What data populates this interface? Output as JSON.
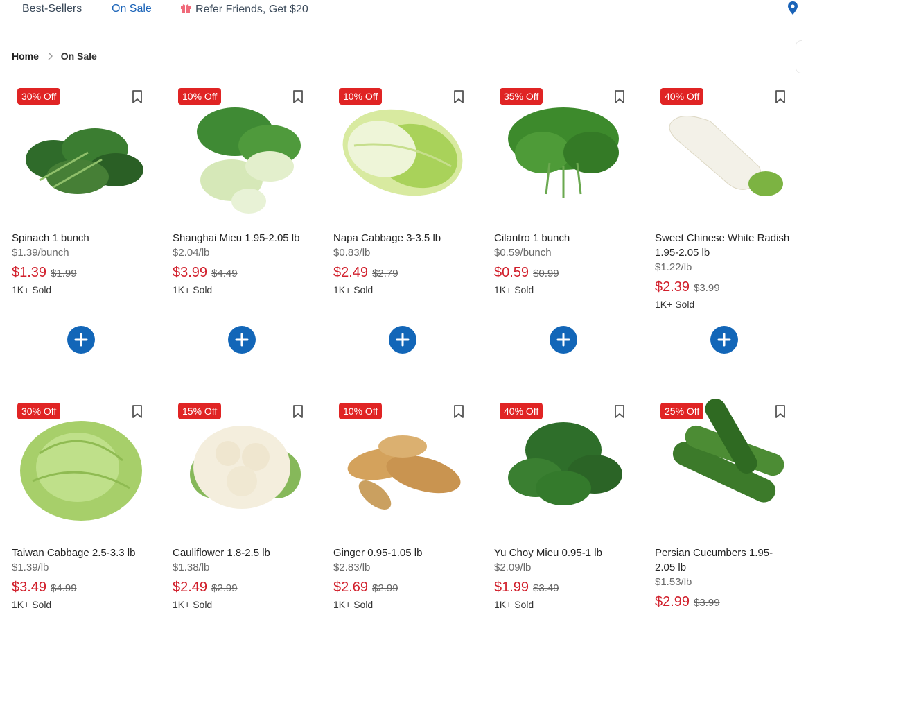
{
  "nav": {
    "best_sellers": "Best-Sellers",
    "on_sale": "On Sale",
    "refer": "Refer Friends, Get $20"
  },
  "breadcrumb": {
    "home": "Home",
    "current": "On Sale"
  },
  "colors": {
    "accent": "#1266b8",
    "badge": "#e02424",
    "price": "#d11f2b"
  },
  "products": [
    {
      "discount": "30% Off",
      "name": "Spinach 1 bunch",
      "unit_price": "$1.39/bunch",
      "price": "$1.39",
      "original_price": "$1.99",
      "sold": "1K+ Sold",
      "image": "spinach"
    },
    {
      "discount": "10% Off",
      "name": "Shanghai Mieu 1.95-2.05 lb",
      "unit_price": "$2.04/lb",
      "price": "$3.99",
      "original_price": "$4.49",
      "sold": "1K+ Sold",
      "image": "bok-choy"
    },
    {
      "discount": "10% Off",
      "name": "Napa Cabbage 3-3.5 lb",
      "unit_price": "$0.83/lb",
      "price": "$2.49",
      "original_price": "$2.79",
      "sold": "1K+ Sold",
      "image": "napa-cabbage"
    },
    {
      "discount": "35% Off",
      "name": "Cilantro 1 bunch",
      "unit_price": "$0.59/bunch",
      "price": "$0.59",
      "original_price": "$0.99",
      "sold": "1K+ Sold",
      "image": "cilantro"
    },
    {
      "discount": "40% Off",
      "name": "Sweet Chinese White Radish 1.95-2.05 lb",
      "unit_price": "$1.22/lb",
      "price": "$2.39",
      "original_price": "$3.99",
      "sold": "1K+ Sold",
      "image": "white-radish"
    },
    {
      "discount": "30% Off",
      "name": "Taiwan Cabbage 2.5-3.3 lb",
      "unit_price": "$1.39/lb",
      "price": "$3.49",
      "original_price": "$4.99",
      "sold": "1K+ Sold",
      "image": "cabbage"
    },
    {
      "discount": "15% Off",
      "name": "Cauliflower 1.8-2.5 lb",
      "unit_price": "$1.38/lb",
      "price": "$2.49",
      "original_price": "$2.99",
      "sold": "1K+ Sold",
      "image": "cauliflower"
    },
    {
      "discount": "10% Off",
      "name": "Ginger 0.95-1.05 lb",
      "unit_price": "$2.83/lb",
      "price": "$2.69",
      "original_price": "$2.99",
      "sold": "1K+ Sold",
      "image": "ginger"
    },
    {
      "discount": "40% Off",
      "name": "Yu Choy Mieu 0.95-1 lb",
      "unit_price": "$2.09/lb",
      "price": "$1.99",
      "original_price": "$3.49",
      "sold": "1K+ Sold",
      "image": "yu-choy"
    },
    {
      "discount": "25% Off",
      "name": "Persian Cucumbers 1.95-2.05 lb",
      "unit_price": "$1.53/lb",
      "price": "$2.99",
      "original_price": "$3.99",
      "sold": "",
      "image": "cucumbers"
    }
  ]
}
